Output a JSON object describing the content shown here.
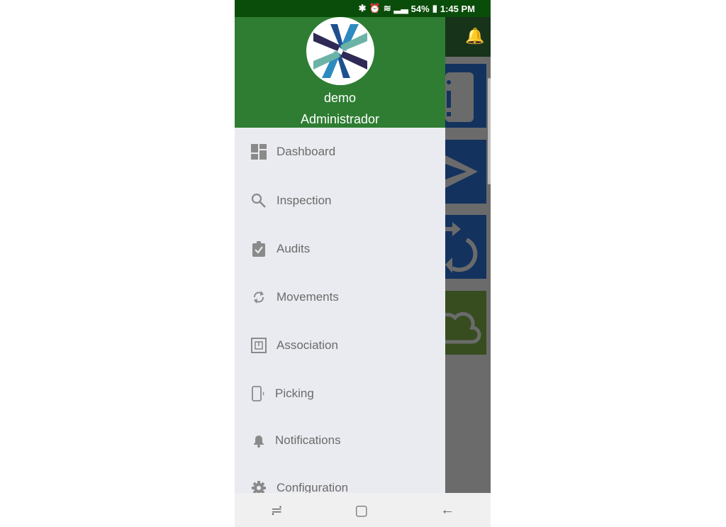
{
  "status_bar": {
    "battery": "54%",
    "time": "1:45 PM",
    "icons": [
      "bluetooth-icon",
      "alarm-icon",
      "wifi-icon",
      "signal-icon",
      "battery-icon"
    ]
  },
  "drawer": {
    "user_name": "demo",
    "user_role": "Administrador",
    "items": [
      {
        "label": "Dashboard",
        "icon": "dashboard-icon"
      },
      {
        "label": "Inspection",
        "icon": "search-icon"
      },
      {
        "label": "Audits",
        "icon": "clipboard-check-icon"
      },
      {
        "label": "Movements",
        "icon": "sync-icon"
      },
      {
        "label": "Association",
        "icon": "nfc-icon"
      },
      {
        "label": "Picking",
        "icon": "phone-signal-icon"
      },
      {
        "label": "Notifications",
        "icon": "bell-icon"
      },
      {
        "label": "Configuration",
        "icon": "gear-icon"
      }
    ]
  },
  "colors": {
    "header": "#2e7d32",
    "status_bar": "#0a4d0a",
    "menu_bg": "#eaebf0",
    "tile_blue": "#13325e",
    "tile_green": "#374d20"
  }
}
